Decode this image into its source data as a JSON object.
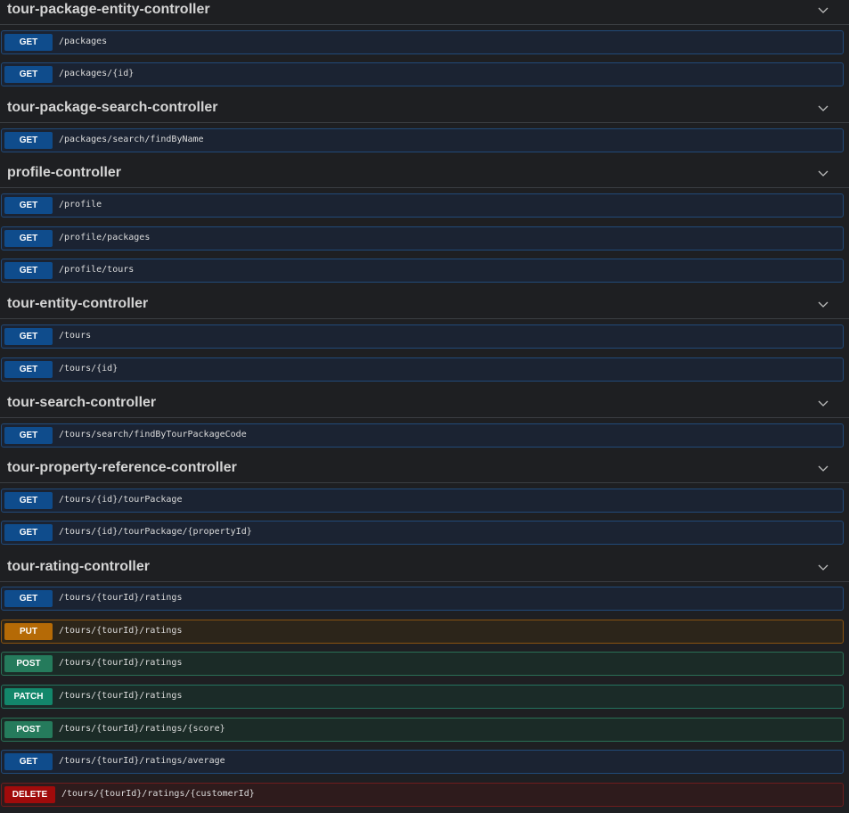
{
  "sections": [
    {
      "title": "tour-package-entity-controller",
      "operations": [
        {
          "method": "GET",
          "path": "/packages"
        },
        {
          "method": "GET",
          "path": "/packages/{id}"
        }
      ]
    },
    {
      "title": "tour-package-search-controller",
      "operations": [
        {
          "method": "GET",
          "path": "/packages/search/findByName"
        }
      ]
    },
    {
      "title": "profile-controller",
      "operations": [
        {
          "method": "GET",
          "path": "/profile"
        },
        {
          "method": "GET",
          "path": "/profile/packages"
        },
        {
          "method": "GET",
          "path": "/profile/tours"
        }
      ]
    },
    {
      "title": "tour-entity-controller",
      "operations": [
        {
          "method": "GET",
          "path": "/tours"
        },
        {
          "method": "GET",
          "path": "/tours/{id}"
        }
      ]
    },
    {
      "title": "tour-search-controller",
      "operations": [
        {
          "method": "GET",
          "path": "/tours/search/findByTourPackageCode"
        }
      ]
    },
    {
      "title": "tour-property-reference-controller",
      "operations": [
        {
          "method": "GET",
          "path": "/tours/{id}/tourPackage"
        },
        {
          "method": "GET",
          "path": "/tours/{id}/tourPackage/{propertyId}"
        }
      ]
    },
    {
      "title": "tour-rating-controller",
      "operations": [
        {
          "method": "GET",
          "path": "/tours/{tourId}/ratings"
        },
        {
          "method": "PUT",
          "path": "/tours/{tourId}/ratings"
        },
        {
          "method": "POST",
          "path": "/tours/{tourId}/ratings"
        },
        {
          "method": "PATCH",
          "path": "/tours/{tourId}/ratings"
        },
        {
          "method": "POST",
          "path": "/tours/{tourId}/ratings/{score}"
        },
        {
          "method": "GET",
          "path": "/tours/{tourId}/ratings/average"
        },
        {
          "method": "DELETE",
          "path": "/tours/{tourId}/ratings/{customerId}"
        }
      ]
    }
  ],
  "icons": {
    "expand": "chevron-down-icon"
  },
  "colors": {
    "get": "#0f4c8c",
    "put": "#b56a06",
    "post": "#257b5c",
    "patch": "#13876b",
    "delete": "#a00b0b"
  }
}
